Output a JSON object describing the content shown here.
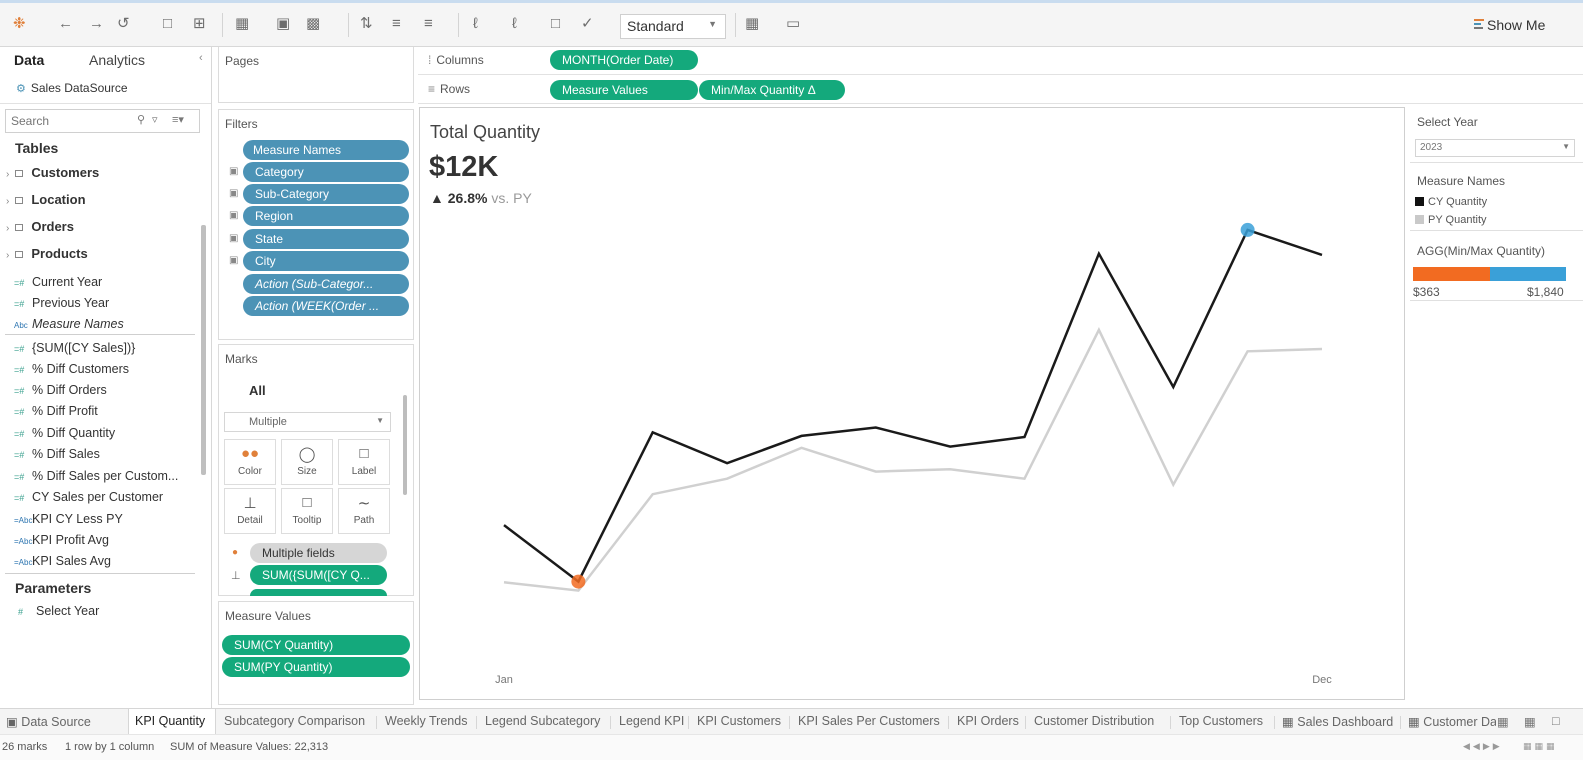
{
  "toolbar": {
    "view_mode": "Standard",
    "show_me": "Show Me"
  },
  "data_pane": {
    "tab_data": "Data",
    "tab_analytics": "Analytics",
    "datasource": "Sales DataSource",
    "search_placeholder": "Search",
    "tables_title": "Tables",
    "tables": [
      {
        "label": "Customers"
      },
      {
        "label": "Location"
      },
      {
        "label": "Orders"
      },
      {
        "label": "Products"
      }
    ],
    "fields": [
      {
        "label": "Current Year",
        "type": "measure"
      },
      {
        "label": "Previous Year",
        "type": "measure"
      },
      {
        "label": "Measure Names",
        "type": "dimension"
      },
      {
        "label": "{SUM([CY Sales])}",
        "type": "measure"
      },
      {
        "label": "% Diff Customers",
        "type": "measure"
      },
      {
        "label": "% Diff Orders",
        "type": "measure"
      },
      {
        "label": "% Diff Profit",
        "type": "measure"
      },
      {
        "label": "% Diff Quantity",
        "type": "measure"
      },
      {
        "label": "% Diff Sales",
        "type": "measure"
      },
      {
        "label": "% Diff Sales per Custom...",
        "type": "measure"
      },
      {
        "label": "CY Sales per Customer",
        "type": "measure"
      },
      {
        "label": "KPI CY Less PY",
        "type": "dimension"
      },
      {
        "label": "KPI Profit Avg",
        "type": "dimension"
      },
      {
        "label": "KPI Sales Avg",
        "type": "dimension"
      }
    ],
    "parameters_title": "Parameters",
    "parameters": [
      {
        "label": "Select Year"
      }
    ]
  },
  "pages_card": {
    "title": "Pages"
  },
  "filters_card": {
    "title": "Filters",
    "pills": [
      {
        "label": "Measure Names"
      },
      {
        "label": "Category"
      },
      {
        "label": "Sub-Category"
      },
      {
        "label": "Region"
      },
      {
        "label": "State"
      },
      {
        "label": "City"
      },
      {
        "label": "Action (Sub-Categor..."
      },
      {
        "label": "Action (WEEK(Order ..."
      }
    ]
  },
  "marks_card": {
    "title": "Marks",
    "all_label": "All",
    "mark_type": "Multiple",
    "buttons": [
      {
        "label": "Color"
      },
      {
        "label": "Size"
      },
      {
        "label": "Label"
      },
      {
        "label": "Detail"
      },
      {
        "label": "Tooltip"
      },
      {
        "label": "Path"
      }
    ],
    "fields": [
      {
        "label": "Multiple fields"
      },
      {
        "label": "SUM({SUM([CY Q..."
      }
    ]
  },
  "measure_values_card": {
    "title": "Measure Values",
    "pills": [
      {
        "label": "SUM(CY Quantity)"
      },
      {
        "label": "SUM(PY Quantity)"
      }
    ]
  },
  "shelves": {
    "columns_label": "Columns",
    "rows_label": "Rows",
    "columns_pill": "MONTH(Order Date)",
    "rows_pills": [
      "Measure Values",
      "Min/Max Quantity Δ"
    ]
  },
  "viz": {
    "title": "Total Quantity",
    "kpi_value": "$12K",
    "delta_arrow": "▲",
    "delta_pct": "26.8%",
    "delta_suffix": "vs. PY",
    "x_start_label": "Jan",
    "x_end_label": "Dec"
  },
  "chart_data": {
    "type": "line",
    "x": [
      "Jan",
      "Feb",
      "Mar",
      "Apr",
      "May",
      "Jun",
      "Jul",
      "Aug",
      "Sep",
      "Oct",
      "Nov",
      "Dec"
    ],
    "series": [
      {
        "name": "CY Quantity",
        "color": "#1a1a1a",
        "values": [
          600,
          363,
          990,
          860,
          975,
          1010,
          930,
          970,
          1740,
          1180,
          1840,
          1735
        ]
      },
      {
        "name": "PY Quantity",
        "color": "#d0d0d0",
        "values": [
          360,
          325,
          730,
          795,
          925,
          825,
          835,
          795,
          1420,
          770,
          1330,
          1340
        ]
      }
    ],
    "min_marker": {
      "month": "Feb",
      "value": 363,
      "color": "#f26b21"
    },
    "max_marker": {
      "month": "Nov",
      "value": 1840,
      "color": "#3aa0d8"
    },
    "ylim": [
      0,
      2100
    ],
    "grid": false
  },
  "legends": {
    "select_year_title": "Select Year",
    "select_year_value": "2023",
    "measure_names_title": "Measure Names",
    "measure_names_items": [
      {
        "label": "CY Quantity",
        "color": "#111111"
      },
      {
        "label": "PY Quantity",
        "color": "#c9c9c9"
      }
    ],
    "minmax_title": "AGG(Min/Max Quantity)",
    "minmax_min_label": "$363",
    "minmax_max_label": "$1,840",
    "minmax_color_low": "#f26b21",
    "minmax_color_high": "#3aa0d8"
  },
  "tabs": [
    {
      "label": "Data Source"
    },
    {
      "label": "KPI Quantity"
    },
    {
      "label": "Subcategory Comparison"
    },
    {
      "label": "Weekly Trends"
    },
    {
      "label": "Legend Subcategory"
    },
    {
      "label": "Legend KPI"
    },
    {
      "label": "KPI Customers"
    },
    {
      "label": "KPI Sales Per Customers"
    },
    {
      "label": "KPI Orders"
    },
    {
      "label": "Customer Distribution"
    },
    {
      "label": "Top Customers"
    },
    {
      "label": "Sales Dashboard"
    },
    {
      "label": "Customer Da"
    }
  ],
  "status": {
    "marks": "26 marks",
    "layout": "1 row by 1 column",
    "sum": "SUM of Measure Values: 22,313"
  }
}
